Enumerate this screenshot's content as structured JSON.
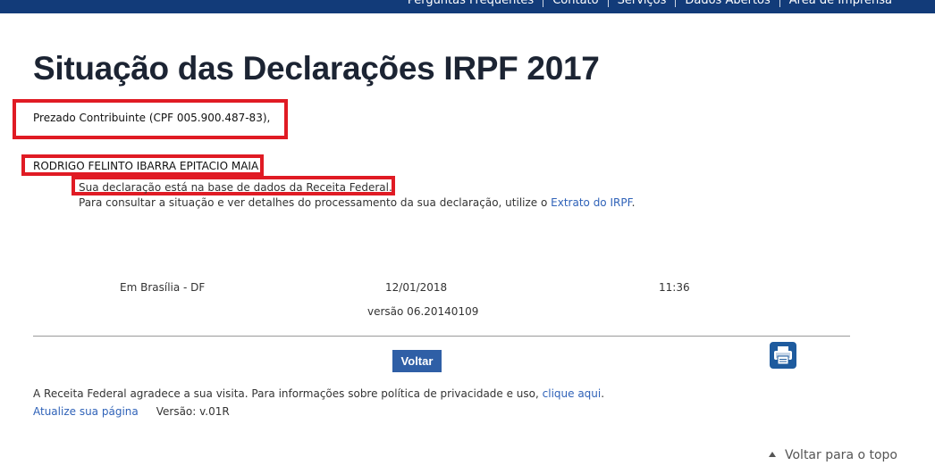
{
  "top_nav": {
    "items": [
      {
        "label": "Perguntas Frequentes"
      },
      {
        "label": "Contato"
      },
      {
        "label": "Serviços"
      },
      {
        "label": "Dados Abertos"
      },
      {
        "label": "Área de Imprensa"
      }
    ]
  },
  "page": {
    "title": "Situação das Declarações IRPF 2017",
    "greeting": "Prezado Contribuinte (CPF 005.900.487-83),",
    "taxpayer_name": "RODRIGO FELINTO IBARRA EPITACIO MAIA",
    "status_message": "Sua declaração está na base de dados da Receita Federal.",
    "consult_text": "Para consultar a situação e ver detalhes do processamento da sua declaração, utilize o ",
    "consult_link": "Extrato do IRPF",
    "consult_suffix": "."
  },
  "meta": {
    "location": "Em Brasília - DF",
    "date": "12/01/2018",
    "time": "11:36",
    "version": "versão 06.20140109"
  },
  "actions": {
    "back_label": "Voltar",
    "print_icon": "printer-icon"
  },
  "footer": {
    "thanks_text": "A Receita Federal agradece a sua visita. Para informações sobre política de privacidade e uso, ",
    "privacy_link": "clique aqui",
    "thanks_suffix": ".",
    "update_link": "Atualize sua página",
    "version": "Versão: v.01R",
    "back_to_top": "Voltar para o topo"
  },
  "colors": {
    "topbar": "#123b79",
    "highlight": "#e01b24",
    "link": "#2f62b8",
    "button": "#2f5fa6"
  }
}
